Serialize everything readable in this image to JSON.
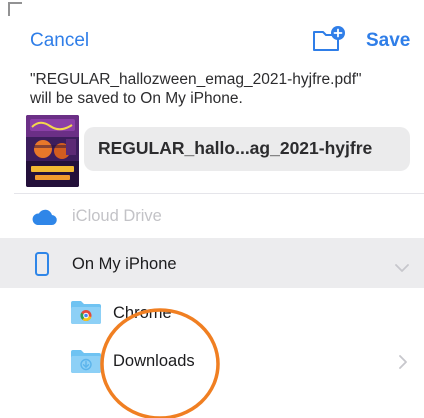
{
  "nav": {
    "cancel_label": "Cancel",
    "save_label": "Save",
    "new_folder_icon": "folder-plus-icon"
  },
  "save_message": {
    "line1": "\"REGULAR_hallozween_emag_2021-hyjfre.pdf\"",
    "line2": "will be saved to On My iPhone."
  },
  "file": {
    "display_name": "REGULAR_hallo...ag_2021-hyjfre",
    "thumbnail_icon": "pdf-cover-thumbnail"
  },
  "locations": [
    {
      "label": "iCloud Drive",
      "icon": "cloud-icon",
      "state": "disabled"
    },
    {
      "label": "On My iPhone",
      "icon": "iphone-icon",
      "state": "selected",
      "disclosure": "chevron-down-icon"
    },
    {
      "label": "Chrome",
      "icon": "chrome-folder-icon",
      "state": "normal"
    },
    {
      "label": "Downloads",
      "icon": "folder-icon",
      "state": "normal",
      "disclosure": "chevron-right-icon"
    }
  ],
  "colors": {
    "accent": "#2f7ee8",
    "selected_row": "#ececee",
    "disabled_text": "#c3c3c7",
    "folder": "#6fc3f2",
    "annotation_circle": "#f07f22"
  }
}
